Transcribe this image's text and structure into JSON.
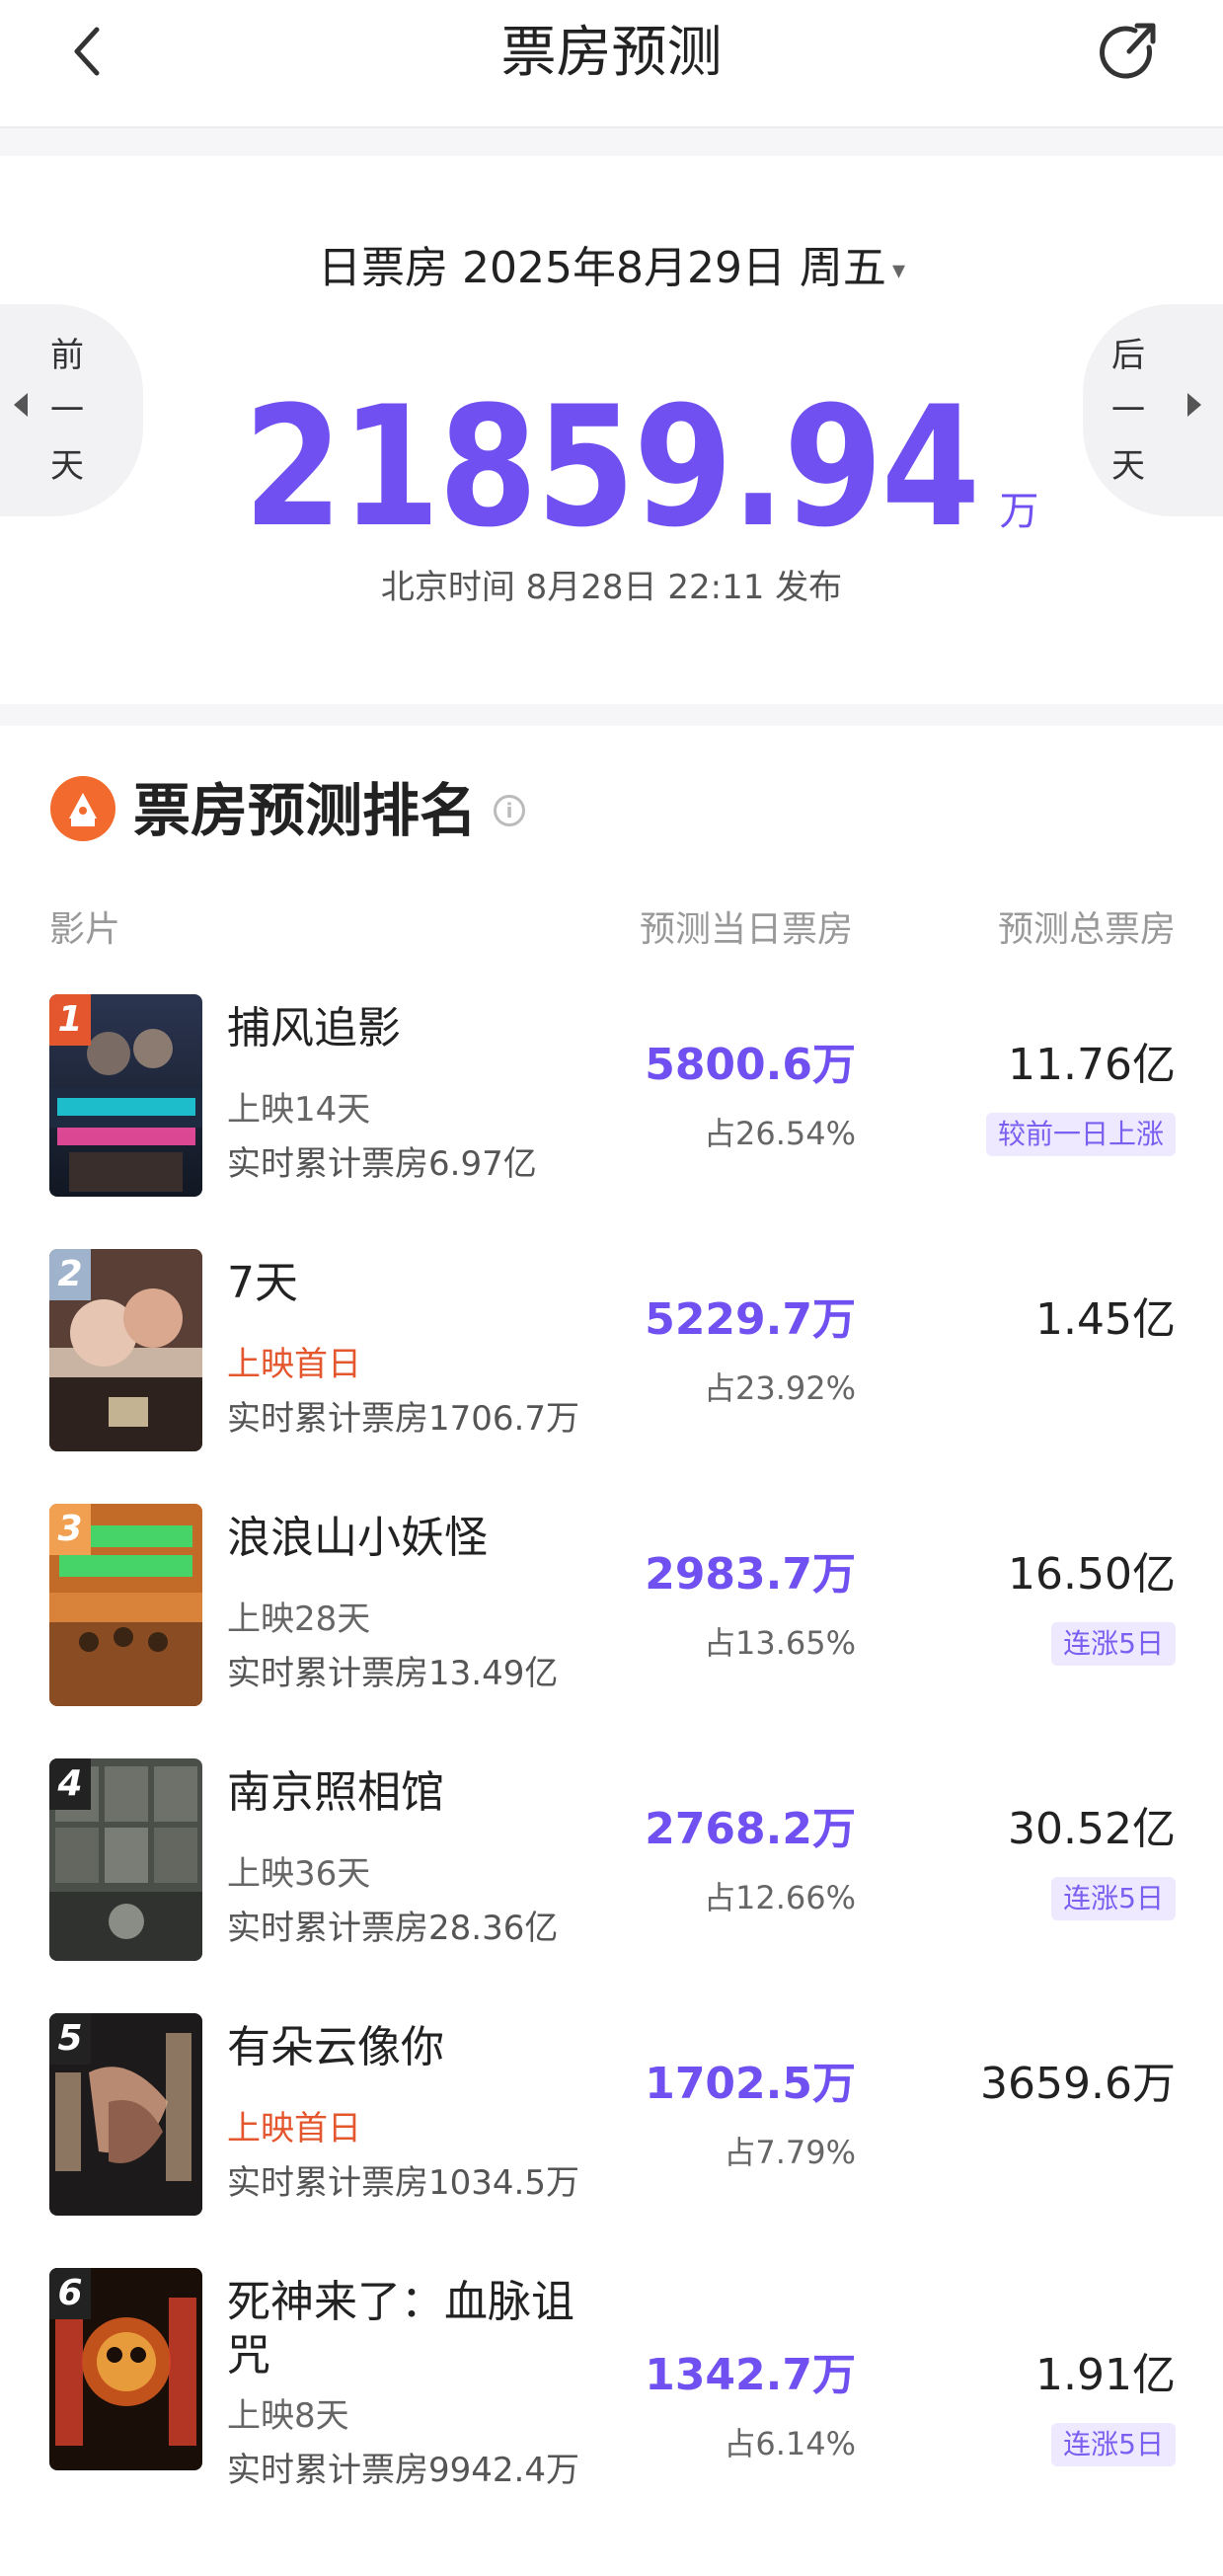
{
  "header": {
    "title": "票房预测",
    "back_icon": "chevron-left-icon",
    "share_icon": "share-refresh-icon"
  },
  "summary": {
    "date_label": "日票房 2025年8月29日 周五",
    "dropdown_caret": "▾",
    "total_value": "21859.94",
    "total_unit": "万",
    "publish_text": "北京时间 8月28日 22:11 发布",
    "prev_day_label": [
      "前",
      "一",
      "天"
    ],
    "next_day_label": [
      "后",
      "一",
      "天"
    ]
  },
  "ranking": {
    "title": "票房预测排名",
    "info_glyph": "i",
    "columns": {
      "film": "影片",
      "day_box": "预测当日票房",
      "total_box": "预测总票房"
    },
    "films": [
      {
        "rank": "1",
        "name": "捕风追影",
        "days": "上映14天",
        "cumulative": "实时累计票房6.97亿",
        "day_box": "5800.6万",
        "share": "占26.54%",
        "total": "11.76亿",
        "tag": "较前一日上涨"
      },
      {
        "rank": "2",
        "name": "7天",
        "days": "上映首日",
        "cumulative": "实时累计票房1706.7万",
        "day_box": "5229.7万",
        "share": "占23.92%",
        "total": "1.45亿",
        "tag": ""
      },
      {
        "rank": "3",
        "name": "浪浪山小妖怪",
        "days": "上映28天",
        "cumulative": "实时累计票房13.49亿",
        "day_box": "2983.7万",
        "share": "占13.65%",
        "total": "16.50亿",
        "tag": "连涨5日"
      },
      {
        "rank": "4",
        "name": "南京照相馆",
        "days": "上映36天",
        "cumulative": "实时累计票房28.36亿",
        "day_box": "2768.2万",
        "share": "占12.66%",
        "total": "30.52亿",
        "tag": "连涨5日"
      },
      {
        "rank": "5",
        "name": "有朵云像你",
        "days": "上映首日",
        "cumulative": "实时累计票房1034.5万",
        "day_box": "1702.5万",
        "share": "占7.79%",
        "total": "3659.6万",
        "tag": ""
      },
      {
        "rank": "6",
        "name": "死神来了：血脉诅咒",
        "days": "上映8天",
        "cumulative": "实时累计票房9942.4万",
        "day_box": "1342.7万",
        "share": "占6.14%",
        "total": "1.91亿",
        "tag": "连涨5日"
      }
    ]
  },
  "colors": {
    "accent": "#7050f0",
    "first_day": "#e4572e",
    "tag_bg": "#eee9ff"
  }
}
